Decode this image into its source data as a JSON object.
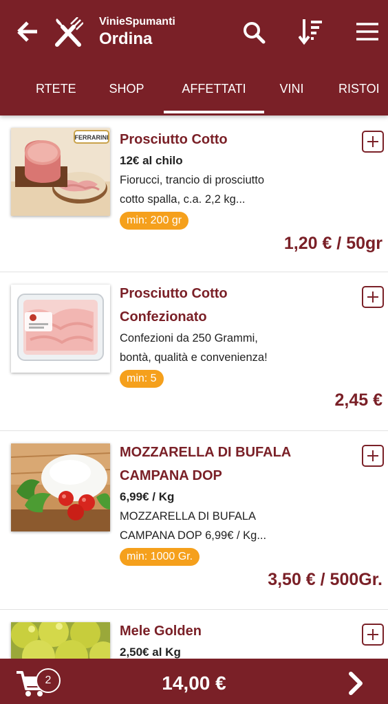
{
  "header": {
    "subtitle": "VinieSpumanti",
    "title": "Ordina"
  },
  "icons": {
    "back": "arrow-left-icon",
    "logo": "fork-knife-icon",
    "search": "search-icon",
    "sort": "sort-icon",
    "menu": "hamburger-menu-icon",
    "cart": "shopping-cart-icon",
    "next": "chevron-right-icon",
    "add": "plus-square-icon"
  },
  "tabs": [
    {
      "label": "RTETE",
      "active": false
    },
    {
      "label": "SHOP",
      "active": false
    },
    {
      "label": "AFFETTATI",
      "active": true
    },
    {
      "label": "VINI",
      "active": false
    },
    {
      "label": "RISTOI",
      "active": false
    }
  ],
  "products": [
    {
      "name": "Prosciutto Cotto",
      "unit_price": "12€ al chilo",
      "description_1": "Fiorucci, trancio di prosciutto",
      "description_2": "cotto spalla, c.a. 2,2 kg...",
      "min": "min: 200 gr",
      "price": "1,20 € / 50gr",
      "image_brand": "FERRARINI"
    },
    {
      "name_1": "Prosciutto Cotto",
      "name_2": "Confezionato",
      "description_1": "Confezioni da 250 Grammi,",
      "description_2": "bontà, qualità e convenienza!",
      "min": "min: 5",
      "price": "2,45 €"
    },
    {
      "name_1": "MOZZARELLA DI BUFALA",
      "name_2": "CAMPANA DOP",
      "unit_price": "6,99€ / Kg",
      "description_1": "MOZZARELLA DI BUFALA",
      "description_2": "CAMPANA DOP 6,99€ / Kg...",
      "min": "min: 1000 Gr.",
      "price": "3,50 € / 500Gr."
    },
    {
      "name": "Mele Golden",
      "unit_price": "2,50€ al Kg"
    }
  ],
  "cart": {
    "count": "2",
    "total": "14,00 €"
  },
  "colors": {
    "brand": "#7a2027",
    "badge": "#f5a01c"
  }
}
